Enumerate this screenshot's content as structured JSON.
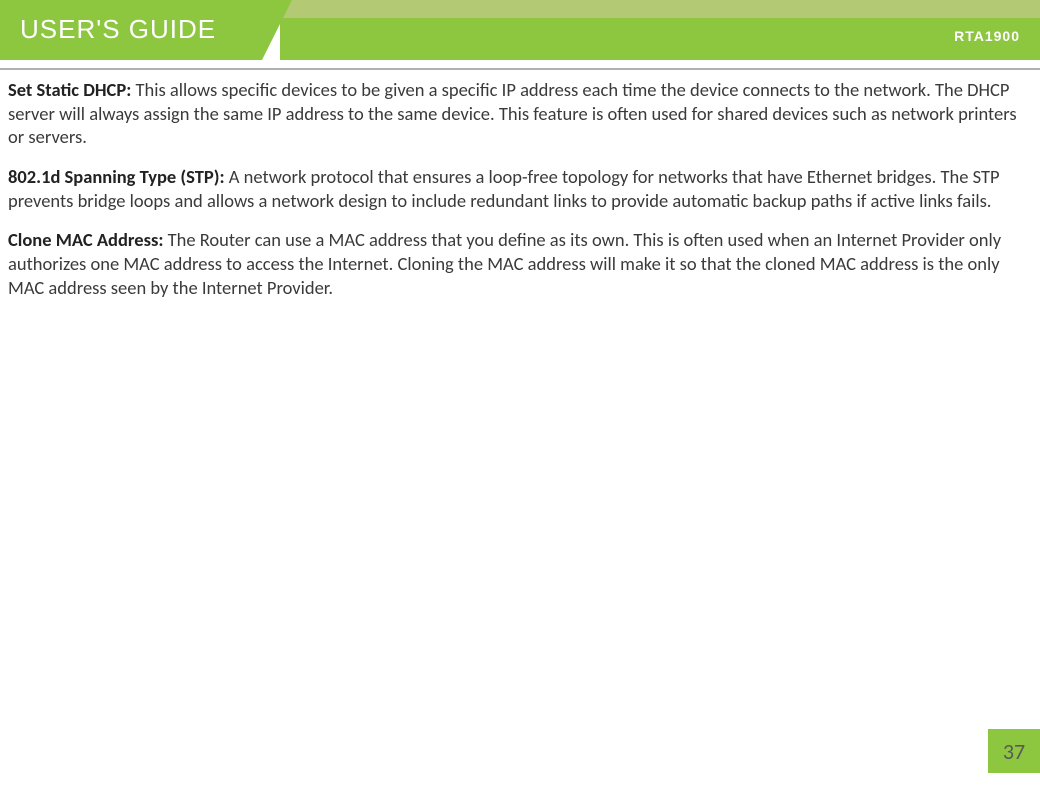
{
  "header": {
    "title": "USER'S GUIDE",
    "model": "RTA1900"
  },
  "paragraphs": [
    {
      "label": "Set Static DHCP:",
      "text": " This allows specific devices to be given a specific IP address each time the device connects to the network. The DHCP server will always assign the same IP address to the same device. This feature is often used for shared devices such as network printers or servers."
    },
    {
      "label": "802.1d Spanning Type (STP):",
      "text": " A network protocol that ensures a loop-free topology for networks that have Ethernet bridges. The STP prevents bridge loops and allows a network design to include redundant links to provide automatic backup paths if active links fails."
    },
    {
      "label": "Clone MAC Address:",
      "text": " The Router can use a MAC address that you define as its own. This is often used when an Internet Provider only authorizes one MAC address to access the Internet. Cloning the MAC address will make it so that the cloned MAC address is the only MAC address seen by the Internet Provider."
    }
  ],
  "pageNumber": "37"
}
